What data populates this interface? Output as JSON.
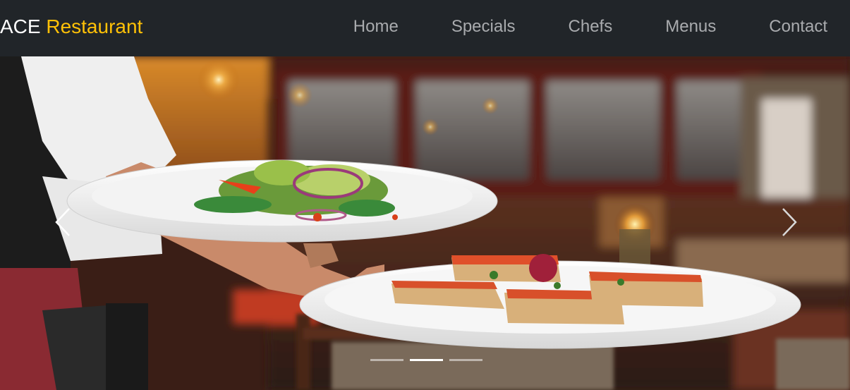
{
  "brand": {
    "text_prefix": "ACE",
    "text_accent": "Restaurant",
    "accent_color": "#ffc107"
  },
  "nav": {
    "items": [
      {
        "label": "Home"
      },
      {
        "label": "Specials"
      },
      {
        "label": "Chefs"
      },
      {
        "label": "Menus"
      },
      {
        "label": "Contact"
      }
    ]
  },
  "carousel": {
    "prev_icon": "chevron-left-icon",
    "next_icon": "chevron-right-icon",
    "slide_count": 3,
    "active_index": 1,
    "image_subject": "waiter carrying salad and bruschetta plates in restaurant"
  }
}
